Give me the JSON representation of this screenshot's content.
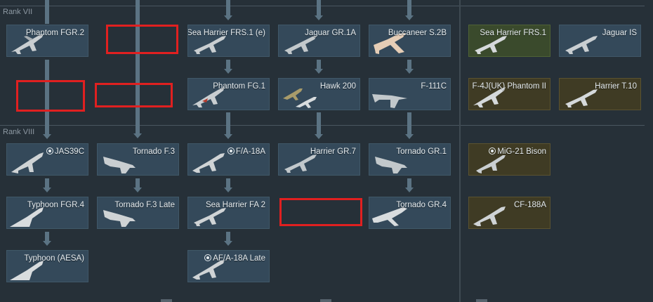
{
  "ranks": [
    {
      "label": "Rank VII"
    },
    {
      "label": "Rank VIII"
    }
  ],
  "vehicles": {
    "phantom_fgr2": "Phantom FGR.2",
    "sea_harrier_frs1e": "Sea Harrier FRS.1 (e)",
    "jaguar_gr1a": "Jaguar GR.1A",
    "buccaneer_s2b": "Buccaneer S.2B",
    "sea_harrier_frs1": "Sea Harrier FRS.1",
    "jaguar_is": "Jaguar IS",
    "phantom_fg1": "Phantom FG.1",
    "hawk_200": "Hawk 200",
    "f111c": "F-111C",
    "f4j_uk": "F-4J(UK) Phantom II",
    "harrier_t10": "Harrier T.10",
    "jas39c": "JAS39C",
    "tornado_f3": "Tornado F.3",
    "fa18a": "F/A-18A",
    "harrier_gr7": "Harrier GR.7",
    "tornado_gr1": "Tornado GR.1",
    "mig21_bison": "MiG-21 Bison",
    "typhoon_fgr4": "Typhoon FGR.4",
    "tornado_f3_late": "Tornado F.3 Late",
    "sea_harrier_fa2": "Sea Harrier FA 2",
    "tornado_gr4": "Tornado GR.4",
    "cf188a": "CF-188A",
    "typhoon_aesa": "Typhoon (AESA)",
    "af18a_late": "AF/A-18A Late"
  },
  "colors": {
    "background": "#263038",
    "card": "#34495a",
    "premium_card": "#3a4a2c",
    "squadron_card": "#3f3b24",
    "connector": "#5b7383",
    "highlight": "#e02020"
  },
  "icons": {
    "aircraft": "jet-silhouette",
    "foreign_marker": "ring-dot"
  }
}
